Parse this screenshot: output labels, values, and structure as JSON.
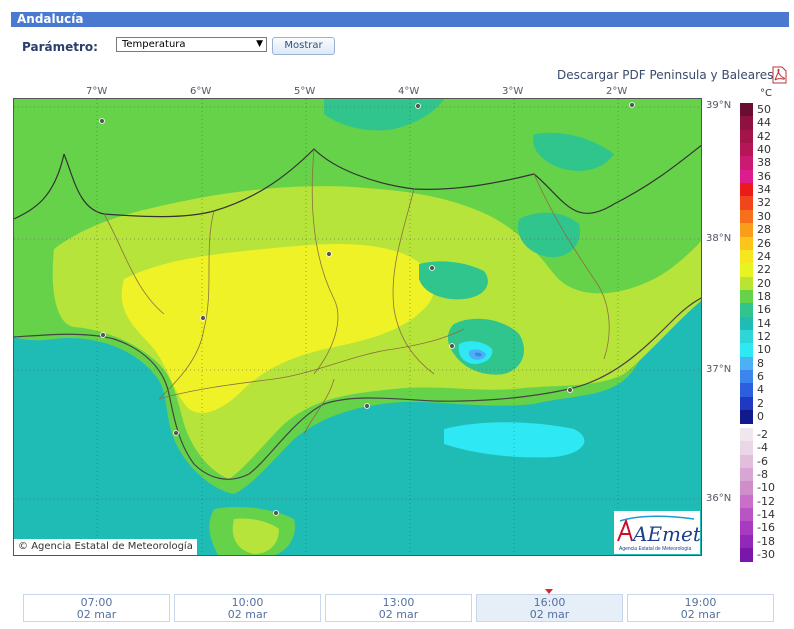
{
  "header": {
    "title": "Andalucía"
  },
  "controls": {
    "param_label": "Parámetro:",
    "param_value": "Temperatura",
    "show_label": "Mostrar"
  },
  "pdf_link": {
    "label": "Descargar PDF Peninsula y Baleares",
    "icon": "pdf-icon"
  },
  "map": {
    "credit": "Agencia Estatal de Meteorología",
    "credit_icon": "copyright-icon",
    "logo_text": "AEmet",
    "logo_subtext": "Agencia Estatal de Meteorología",
    "longitudes": [
      "7°W",
      "6°W",
      "5°W",
      "4°W",
      "3°W",
      "2°W"
    ],
    "latitudes": [
      "39°N",
      "38°N",
      "37°N",
      "36°N"
    ],
    "colors": {
      "sea": "#1fbcb6",
      "land_low": "#66d24a",
      "land_mid": "#b7e43a",
      "land_high": "#eef226",
      "cool": "#38d6e8"
    }
  },
  "legend": {
    "unit": "°C",
    "positive": [
      {
        "label": "50",
        "color": "#6a0d32"
      },
      {
        "label": "44",
        "color": "#8e1142"
      },
      {
        "label": "42",
        "color": "#a3144b"
      },
      {
        "label": "40",
        "color": "#b51656"
      },
      {
        "label": "38",
        "color": "#cb1a74"
      },
      {
        "label": "36",
        "color": "#dd1c8d"
      },
      {
        "label": "34",
        "color": "#ec1b1b"
      },
      {
        "label": "32",
        "color": "#f0461a"
      },
      {
        "label": "30",
        "color": "#f67019"
      },
      {
        "label": "28",
        "color": "#f99d1a"
      },
      {
        "label": "26",
        "color": "#fbc51c"
      },
      {
        "label": "24",
        "color": "#f6e61f"
      },
      {
        "label": "22",
        "color": "#e7f421"
      },
      {
        "label": "20",
        "color": "#b9e532"
      },
      {
        "label": "18",
        "color": "#66d24a"
      },
      {
        "label": "16",
        "color": "#2fc58d"
      },
      {
        "label": "14",
        "color": "#1fbcb6"
      },
      {
        "label": "12",
        "color": "#2fd6d8"
      },
      {
        "label": "10",
        "color": "#2ee8f4"
      },
      {
        "label": "8",
        "color": "#4bb0f4"
      },
      {
        "label": "6",
        "color": "#3a86ec"
      },
      {
        "label": "4",
        "color": "#2b5fde"
      },
      {
        "label": "2",
        "color": "#1f39c2"
      },
      {
        "label": "0",
        "color": "#101a8c"
      }
    ],
    "negative": [
      {
        "label": "-2",
        "color": "#efe6ee"
      },
      {
        "label": "-4",
        "color": "#ead6e6"
      },
      {
        "label": "-6",
        "color": "#e1bfdc"
      },
      {
        "label": "-8",
        "color": "#d7a6d2"
      },
      {
        "label": "-10",
        "color": "#cf8ecb"
      },
      {
        "label": "-12",
        "color": "#c86fc8"
      },
      {
        "label": "-14",
        "color": "#b954c4"
      },
      {
        "label": "-16",
        "color": "#a83ac0"
      },
      {
        "label": "-18",
        "color": "#9327b8"
      },
      {
        "label": "-30",
        "color": "#7a16aa"
      }
    ]
  },
  "timeline": {
    "active_index": 3,
    "items": [
      {
        "time": "07:00",
        "date": "02 mar"
      },
      {
        "time": "10:00",
        "date": "02 mar"
      },
      {
        "time": "13:00",
        "date": "02 mar"
      },
      {
        "time": "16:00",
        "date": "02 mar"
      },
      {
        "time": "19:00",
        "date": "02 mar"
      }
    ]
  }
}
